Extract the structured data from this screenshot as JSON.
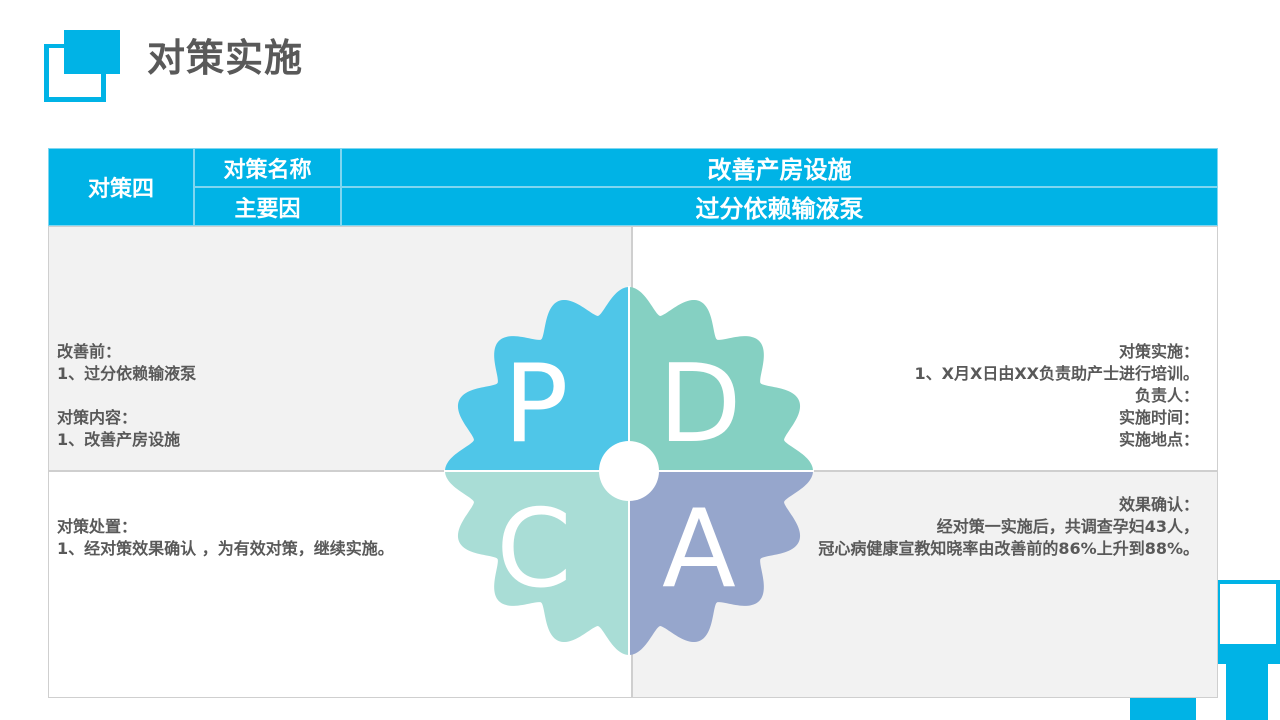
{
  "title": "对策实施",
  "header": {
    "label": "对策四",
    "rows": [
      {
        "key": "对策名称",
        "value": "改善产房设施"
      },
      {
        "key": "主要因",
        "value": "过分依赖输液泵"
      }
    ]
  },
  "quadrants": {
    "top_left": {
      "lines1": [
        "改善前：",
        "1、过分依赖输液泵"
      ],
      "lines2": [
        "对策内容：",
        "1、改善产房设施"
      ]
    },
    "top_right": {
      "lines": [
        "对策实施：",
        "1、X月X日由XX负责助产士进行培训。",
        "负责人：",
        "实施时间：",
        "实施地点："
      ]
    },
    "bottom_left": {
      "lines": [
        "对策处置：",
        "1、经对策效果确认 ，为有效对策，继续实施。"
      ]
    },
    "bottom_right": {
      "lines": [
        "效果确认：",
        "经对策一实施后，共调查孕妇43人，",
        "冠心病健康宣教知晓率由改善前的86%上升到88%。"
      ]
    }
  },
  "pdca": {
    "letters": [
      "P",
      "D",
      "C",
      "A"
    ],
    "colors": {
      "P": "#4fc6e8",
      "D": "#85d0c2",
      "C": "#a9ddd6",
      "A": "#96a6cc"
    }
  },
  "colors": {
    "accent": "#00b3e6",
    "title_text": "#595959"
  }
}
